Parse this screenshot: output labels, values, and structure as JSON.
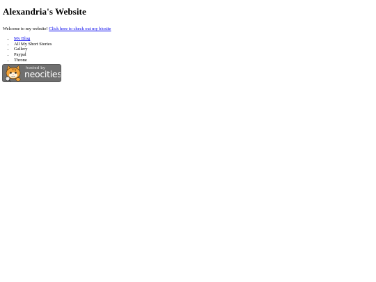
{
  "page": {
    "title": "Alexandria's Website",
    "welcome_text": "Welcome to my website!",
    "biosite_link": "Click here to check out my biosite"
  },
  "nav": {
    "items": [
      {
        "label": "My Blog",
        "is_link": true
      },
      {
        "label": "All My Short Stories",
        "is_link": false
      },
      {
        "label": "Gallery",
        "is_link": false
      },
      {
        "label": "Paypal",
        "is_link": false
      },
      {
        "label": "Throne",
        "is_link": false
      }
    ]
  },
  "badge": {
    "hosted_label": "hosted by",
    "brand_label": "neocities",
    "icon": "neocities-cat-icon"
  },
  "colors": {
    "link": "#0000ee",
    "badge_bg": "#6f6f6f",
    "cat_orange": "#f2a33a"
  }
}
